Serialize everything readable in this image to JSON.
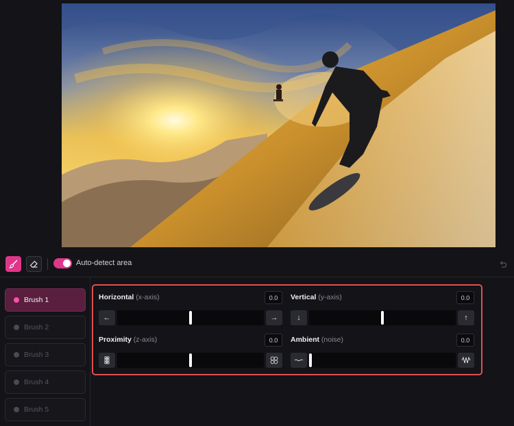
{
  "preview": {
    "description_icon": "photo-preview"
  },
  "toolbar": {
    "brush_icon": "paintbrush-icon",
    "eraser_icon": "eraser-icon",
    "toggle_label": "Auto-detect area",
    "toggle_on": true,
    "undo_icon": "undo-icon"
  },
  "brushes": [
    {
      "label": "Brush 1",
      "active": true
    },
    {
      "label": "Brush 2",
      "active": false
    },
    {
      "label": "Brush 3",
      "active": false
    },
    {
      "label": "Brush 4",
      "active": false
    },
    {
      "label": "Brush 5",
      "active": false
    }
  ],
  "controls": {
    "horizontal": {
      "title": "Horizontal",
      "sub": "(x-axis)",
      "value": "0.0",
      "position": 0.5,
      "left_icon": "arrow-left-icon",
      "right_icon": "arrow-right-icon",
      "left_glyph": "←",
      "right_glyph": "→"
    },
    "vertical": {
      "title": "Vertical",
      "sub": "(y-axis)",
      "value": "0.0",
      "position": 0.5,
      "left_icon": "arrow-down-icon",
      "right_icon": "arrow-up-icon",
      "left_glyph": "↓",
      "right_glyph": "↑"
    },
    "proximity": {
      "title": "Proximity",
      "sub": "(z-axis)",
      "value": "0.0",
      "position": 0.5,
      "left_icon": "shrink-icon",
      "right_icon": "expand-icon"
    },
    "ambient": {
      "title": "Ambient",
      "sub": "(noise)",
      "value": "0.0",
      "position": 0.0,
      "left_icon": "wave-low-icon",
      "right_icon": "wave-high-icon"
    }
  },
  "colors": {
    "accent": "#e0368a",
    "highlight_border": "#e2504f",
    "background": "#131318"
  }
}
